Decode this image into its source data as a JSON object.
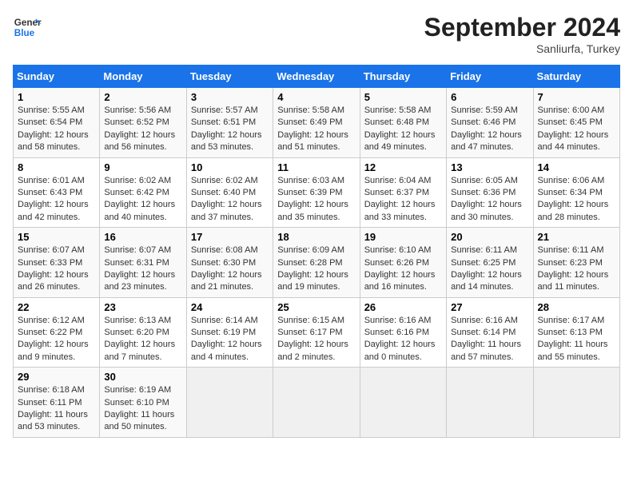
{
  "header": {
    "logo_line1": "General",
    "logo_line2": "Blue",
    "month": "September 2024",
    "location": "Sanliurfa, Turkey"
  },
  "weekdays": [
    "Sunday",
    "Monday",
    "Tuesday",
    "Wednesday",
    "Thursday",
    "Friday",
    "Saturday"
  ],
  "weeks": [
    [
      {
        "day": "1",
        "info": "Sunrise: 5:55 AM\nSunset: 6:54 PM\nDaylight: 12 hours\nand 58 minutes."
      },
      {
        "day": "2",
        "info": "Sunrise: 5:56 AM\nSunset: 6:52 PM\nDaylight: 12 hours\nand 56 minutes."
      },
      {
        "day": "3",
        "info": "Sunrise: 5:57 AM\nSunset: 6:51 PM\nDaylight: 12 hours\nand 53 minutes."
      },
      {
        "day": "4",
        "info": "Sunrise: 5:58 AM\nSunset: 6:49 PM\nDaylight: 12 hours\nand 51 minutes."
      },
      {
        "day": "5",
        "info": "Sunrise: 5:58 AM\nSunset: 6:48 PM\nDaylight: 12 hours\nand 49 minutes."
      },
      {
        "day": "6",
        "info": "Sunrise: 5:59 AM\nSunset: 6:46 PM\nDaylight: 12 hours\nand 47 minutes."
      },
      {
        "day": "7",
        "info": "Sunrise: 6:00 AM\nSunset: 6:45 PM\nDaylight: 12 hours\nand 44 minutes."
      }
    ],
    [
      {
        "day": "8",
        "info": "Sunrise: 6:01 AM\nSunset: 6:43 PM\nDaylight: 12 hours\nand 42 minutes."
      },
      {
        "day": "9",
        "info": "Sunrise: 6:02 AM\nSunset: 6:42 PM\nDaylight: 12 hours\nand 40 minutes."
      },
      {
        "day": "10",
        "info": "Sunrise: 6:02 AM\nSunset: 6:40 PM\nDaylight: 12 hours\nand 37 minutes."
      },
      {
        "day": "11",
        "info": "Sunrise: 6:03 AM\nSunset: 6:39 PM\nDaylight: 12 hours\nand 35 minutes."
      },
      {
        "day": "12",
        "info": "Sunrise: 6:04 AM\nSunset: 6:37 PM\nDaylight: 12 hours\nand 33 minutes."
      },
      {
        "day": "13",
        "info": "Sunrise: 6:05 AM\nSunset: 6:36 PM\nDaylight: 12 hours\nand 30 minutes."
      },
      {
        "day": "14",
        "info": "Sunrise: 6:06 AM\nSunset: 6:34 PM\nDaylight: 12 hours\nand 28 minutes."
      }
    ],
    [
      {
        "day": "15",
        "info": "Sunrise: 6:07 AM\nSunset: 6:33 PM\nDaylight: 12 hours\nand 26 minutes."
      },
      {
        "day": "16",
        "info": "Sunrise: 6:07 AM\nSunset: 6:31 PM\nDaylight: 12 hours\nand 23 minutes."
      },
      {
        "day": "17",
        "info": "Sunrise: 6:08 AM\nSunset: 6:30 PM\nDaylight: 12 hours\nand 21 minutes."
      },
      {
        "day": "18",
        "info": "Sunrise: 6:09 AM\nSunset: 6:28 PM\nDaylight: 12 hours\nand 19 minutes."
      },
      {
        "day": "19",
        "info": "Sunrise: 6:10 AM\nSunset: 6:26 PM\nDaylight: 12 hours\nand 16 minutes."
      },
      {
        "day": "20",
        "info": "Sunrise: 6:11 AM\nSunset: 6:25 PM\nDaylight: 12 hours\nand 14 minutes."
      },
      {
        "day": "21",
        "info": "Sunrise: 6:11 AM\nSunset: 6:23 PM\nDaylight: 12 hours\nand 11 minutes."
      }
    ],
    [
      {
        "day": "22",
        "info": "Sunrise: 6:12 AM\nSunset: 6:22 PM\nDaylight: 12 hours\nand 9 minutes."
      },
      {
        "day": "23",
        "info": "Sunrise: 6:13 AM\nSunset: 6:20 PM\nDaylight: 12 hours\nand 7 minutes."
      },
      {
        "day": "24",
        "info": "Sunrise: 6:14 AM\nSunset: 6:19 PM\nDaylight: 12 hours\nand 4 minutes."
      },
      {
        "day": "25",
        "info": "Sunrise: 6:15 AM\nSunset: 6:17 PM\nDaylight: 12 hours\nand 2 minutes."
      },
      {
        "day": "26",
        "info": "Sunrise: 6:16 AM\nSunset: 6:16 PM\nDaylight: 12 hours\nand 0 minutes."
      },
      {
        "day": "27",
        "info": "Sunrise: 6:16 AM\nSunset: 6:14 PM\nDaylight: 11 hours\nand 57 minutes."
      },
      {
        "day": "28",
        "info": "Sunrise: 6:17 AM\nSunset: 6:13 PM\nDaylight: 11 hours\nand 55 minutes."
      }
    ],
    [
      {
        "day": "29",
        "info": "Sunrise: 6:18 AM\nSunset: 6:11 PM\nDaylight: 11 hours\nand 53 minutes."
      },
      {
        "day": "30",
        "info": "Sunrise: 6:19 AM\nSunset: 6:10 PM\nDaylight: 11 hours\nand 50 minutes."
      },
      {
        "day": "",
        "info": ""
      },
      {
        "day": "",
        "info": ""
      },
      {
        "day": "",
        "info": ""
      },
      {
        "day": "",
        "info": ""
      },
      {
        "day": "",
        "info": ""
      }
    ]
  ]
}
